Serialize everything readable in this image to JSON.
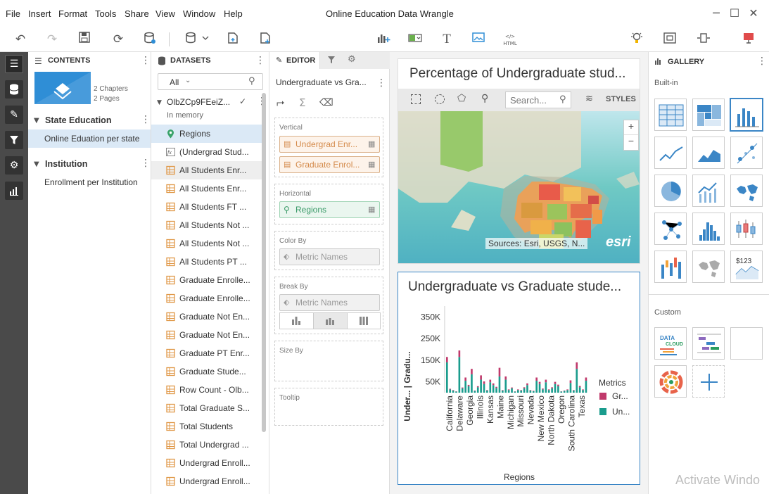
{
  "menu": {
    "items": [
      "File",
      "Insert",
      "Format",
      "Tools",
      "Share",
      "View",
      "Window",
      "Help"
    ],
    "window_title": "Online Education Data Wrangle"
  },
  "contents": {
    "header": "CONTENTS",
    "thumb_meta": {
      "chapters": "2 Chapters",
      "pages": "2 Pages"
    },
    "sections": [
      {
        "title": "State Education",
        "pages": [
          "Online Eduation per state"
        ]
      },
      {
        "title": "Institution",
        "pages": [
          "Enrollment per Institution"
        ]
      }
    ]
  },
  "datasets": {
    "header": "DATASETS",
    "filter_value": "All",
    "dataset_name": "OlbZCp9FEeiZ...",
    "dataset_status": "In memory",
    "columns": [
      {
        "label": "Regions",
        "type": "geo"
      },
      {
        "label": "(Undergrad Stud...",
        "type": "calc"
      },
      {
        "label": "All Students Enr...",
        "type": "measure"
      },
      {
        "label": "All Students Enr...",
        "type": "measure"
      },
      {
        "label": "All Students FT ...",
        "type": "measure"
      },
      {
        "label": "All Students Not ...",
        "type": "measure"
      },
      {
        "label": "All Students Not ...",
        "type": "measure"
      },
      {
        "label": "All Students PT ...",
        "type": "measure"
      },
      {
        "label": "Graduate Enrolle...",
        "type": "measure"
      },
      {
        "label": "Graduate Enrolle...",
        "type": "measure"
      },
      {
        "label": "Graduate Not En...",
        "type": "measure"
      },
      {
        "label": "Graduate Not En...",
        "type": "measure"
      },
      {
        "label": "Graduate PT Enr...",
        "type": "measure"
      },
      {
        "label": "Graduate Stude...",
        "type": "measure"
      },
      {
        "label": "Row Count - Olb...",
        "type": "measure"
      },
      {
        "label": "Total Graduate S...",
        "type": "measure"
      },
      {
        "label": "Total Students",
        "type": "measure"
      },
      {
        "label": "Total Undergrad ...",
        "type": "measure"
      },
      {
        "label": "Undergrad Enroll...",
        "type": "measure"
      },
      {
        "label": "Undergrad Enroll...",
        "type": "measure"
      }
    ]
  },
  "editor": {
    "tab_label": "EDITOR",
    "viz_name": "Undergraduate vs Gra...",
    "zones": {
      "vertical": {
        "title": "Vertical",
        "pills": [
          "Undergrad Enr...",
          "Graduate Enrol..."
        ]
      },
      "horizontal": {
        "title": "Horizontal",
        "pills": [
          "Regions"
        ]
      },
      "color_by": {
        "title": "Color By",
        "pills": [
          "Metric Names"
        ]
      },
      "break_by": {
        "title": "Break By",
        "pills": [
          "Metric Names"
        ]
      },
      "size_by": {
        "title": "Size By"
      },
      "tooltip": {
        "title": "Tooltip"
      }
    }
  },
  "map_viz": {
    "title": "Percentage of Undergraduate stud...",
    "search_placeholder": "Search...",
    "styles_label": "STYLES",
    "zoom_in": "+",
    "zoom_out": "−",
    "attribution": "Sources: Esri, USGS, N...",
    "logo": "esri"
  },
  "bar_viz": {
    "title": "Undergraduate vs Graduate stude...",
    "ylabel": "Under... | Gradu...",
    "xlabel": "Regions",
    "legend_title": "Metrics",
    "legend_items": [
      {
        "label": "Gr...",
        "color": "#c0396b"
      },
      {
        "label": "Un...",
        "color": "#1a9c8d"
      }
    ]
  },
  "chart_data": {
    "type": "bar",
    "stacked": true,
    "xlabel": "Regions",
    "ylabel": "Under... | Gradu...",
    "ylim": [
      0,
      400000
    ],
    "yticks": [
      "50K",
      "150K",
      "250K",
      "350K"
    ],
    "ytick_values": [
      50000,
      150000,
      250000,
      350000
    ],
    "x_tick_labels": [
      "California",
      "Delaware",
      "Georgia",
      "Illinois",
      "Kansas",
      "Maine",
      "Michigan",
      "Missouri",
      "Nevada",
      "New Mexico",
      "North Dakota",
      "Oregon",
      "South Carolina",
      "Texas"
    ],
    "series": [
      {
        "name": "Un...",
        "color": "#1a9c8d",
        "values": [
          140000,
          15000,
          10000,
          5000,
          165000,
          20000,
          55000,
          30000,
          85000,
          8000,
          25000,
          60000,
          40000,
          10000,
          48000,
          35000,
          22000,
          75000,
          10000,
          60000,
          12000,
          20000,
          5000,
          12000,
          10000,
          20000,
          35000,
          10000,
          7000,
          55000,
          40000,
          15000,
          48000,
          12000,
          20000,
          40000,
          30000,
          5000,
          8000,
          12000,
          45000,
          10000,
          110000,
          25000,
          12000,
          55000
        ]
      },
      {
        "name": "Gr...",
        "color": "#c0396b",
        "values": [
          25000,
          3000,
          2000,
          1000,
          30000,
          4000,
          15000,
          6000,
          25000,
          2000,
          5000,
          20000,
          12000,
          2000,
          12000,
          8000,
          5000,
          40000,
          2000,
          15000,
          3000,
          4000,
          1000,
          3000,
          2000,
          5000,
          8000,
          2000,
          2000,
          15000,
          10000,
          4000,
          12000,
          3000,
          5000,
          10000,
          7000,
          1000,
          2000,
          3000,
          12000,
          2000,
          30000,
          6000,
          3000,
          15000
        ]
      }
    ]
  }
}
